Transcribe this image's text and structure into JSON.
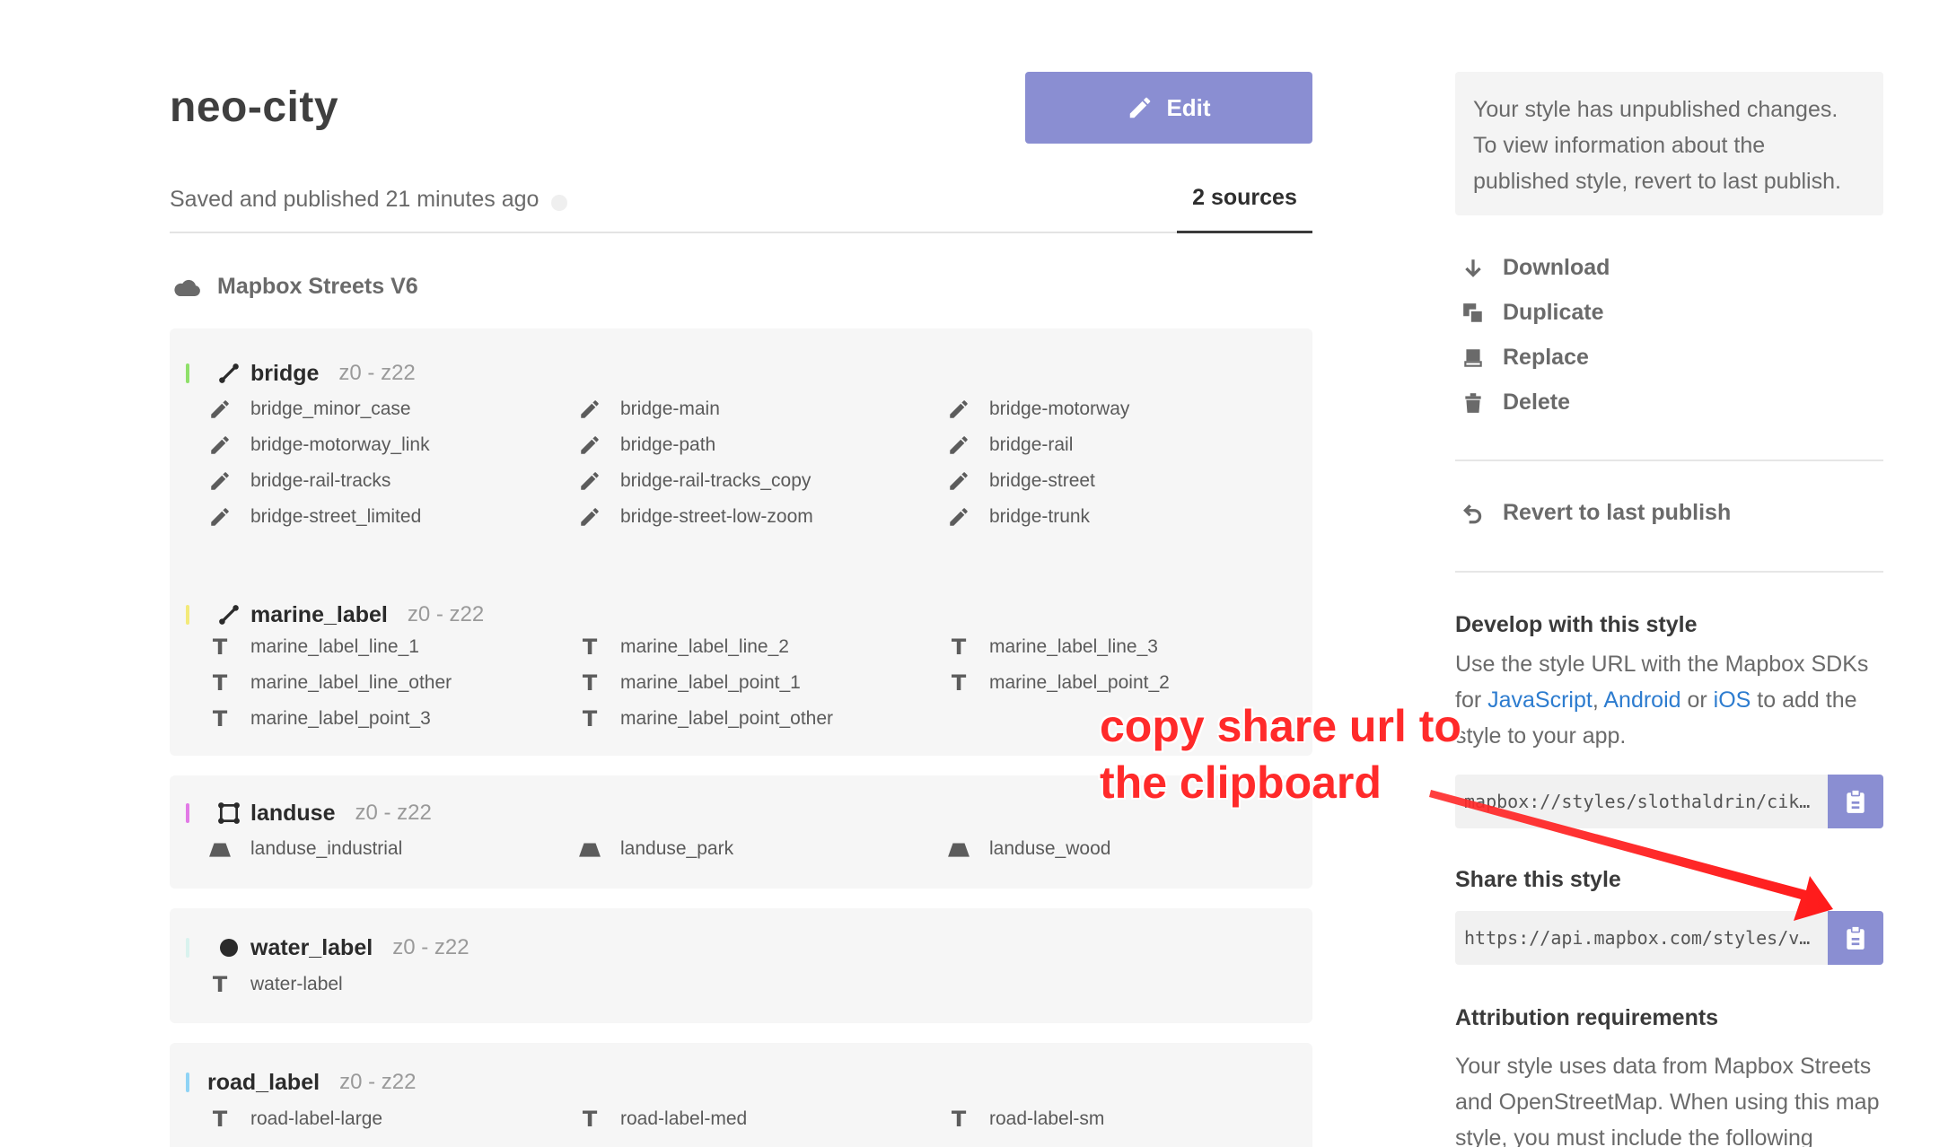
{
  "header": {
    "title": "neo-city",
    "edit_label": "Edit",
    "saved_text": "Saved and published 21 minutes ago",
    "sources_tab": "2 sources"
  },
  "source": {
    "name": "Mapbox Streets V6",
    "icon": "cloud-icon"
  },
  "groups": [
    {
      "name": "bridge",
      "zoom": "z0 - z22",
      "color": "#8fe06a",
      "icon": "line-icon",
      "layers": [
        {
          "name": "bridge_minor_case",
          "icon": "pencil-icon"
        },
        {
          "name": "bridge-main",
          "icon": "pencil-icon"
        },
        {
          "name": "bridge-motorway",
          "icon": "pencil-icon"
        },
        {
          "name": "bridge-motorway_link",
          "icon": "pencil-icon"
        },
        {
          "name": "bridge-path",
          "icon": "pencil-icon"
        },
        {
          "name": "bridge-rail",
          "icon": "pencil-icon"
        },
        {
          "name": "bridge-rail-tracks",
          "icon": "pencil-icon"
        },
        {
          "name": "bridge-rail-tracks_copy",
          "icon": "pencil-icon"
        },
        {
          "name": "bridge-street",
          "icon": "pencil-icon"
        },
        {
          "name": "bridge-street_limited",
          "icon": "pencil-icon"
        },
        {
          "name": "bridge-street-low-zoom",
          "icon": "pencil-icon"
        },
        {
          "name": "bridge-trunk",
          "icon": "pencil-icon"
        }
      ]
    },
    {
      "name": "marine_label",
      "zoom": "z0 - z22",
      "color": "#f3ea7a",
      "icon": "line-icon",
      "layers": [
        {
          "name": "marine_label_line_1",
          "icon": "text-icon"
        },
        {
          "name": "marine_label_line_2",
          "icon": "text-icon"
        },
        {
          "name": "marine_label_line_3",
          "icon": "text-icon"
        },
        {
          "name": "marine_label_line_other",
          "icon": "text-icon"
        },
        {
          "name": "marine_label_point_1",
          "icon": "text-icon"
        },
        {
          "name": "marine_label_point_2",
          "icon": "text-icon"
        },
        {
          "name": "marine_label_point_3",
          "icon": "text-icon"
        },
        {
          "name": "marine_label_point_other",
          "icon": "text-icon"
        }
      ]
    },
    {
      "name": "landuse",
      "zoom": "z0 - z22",
      "color": "#e27ae6",
      "icon": "polygon-icon",
      "layers": [
        {
          "name": "landuse_industrial",
          "icon": "fill-icon"
        },
        {
          "name": "landuse_park",
          "icon": "fill-icon"
        },
        {
          "name": "landuse_wood",
          "icon": "fill-icon"
        }
      ]
    },
    {
      "name": "water_label",
      "zoom": "z0 - z22",
      "color": "#d9f2ee",
      "icon": "point-icon",
      "layers": [
        {
          "name": "water-label",
          "icon": "text-icon"
        }
      ]
    },
    {
      "name": "road_label",
      "zoom": "z0 - z22",
      "color": "#8fd3f5",
      "icon": "",
      "layers": [
        {
          "name": "road-label-large",
          "icon": "text-icon"
        },
        {
          "name": "road-label-med",
          "icon": "text-icon"
        },
        {
          "name": "road-label-sm",
          "icon": "text-icon"
        }
      ]
    }
  ],
  "sidebar": {
    "notice": "Your style has unpublished changes. To view information about the published style, revert to last publish.",
    "actions": [
      {
        "label": "Download",
        "icon": "download-icon"
      },
      {
        "label": "Duplicate",
        "icon": "duplicate-icon"
      },
      {
        "label": "Replace",
        "icon": "replace-icon"
      },
      {
        "label": "Delete",
        "icon": "trash-icon"
      }
    ],
    "revert_label": "Revert to last publish",
    "develop": {
      "heading": "Develop with this style",
      "text_before": "Use the style URL with the Mapbox SDKs for ",
      "link_js": "JavaScript",
      "sep1": ", ",
      "link_android": "Android",
      "sep2": " or ",
      "link_ios": "iOS",
      "text_after": " to add the style to your app.",
      "url": "mapbox://styles/slothaldrin/cik…"
    },
    "share": {
      "heading": "Share this style",
      "url": "https://api.mapbox.com/styles/v…"
    },
    "attribution": {
      "heading": "Attribution requirements",
      "text": "Your style uses data from Mapbox Streets and OpenStreetMap. When using this map style, you must include the following"
    }
  },
  "annotation": {
    "line1": "copy share url to",
    "line2": "the clipboard",
    "color": "#ff2a2a"
  },
  "colors": {
    "accent": "#8a8ed2",
    "link": "#2d7ccf"
  }
}
